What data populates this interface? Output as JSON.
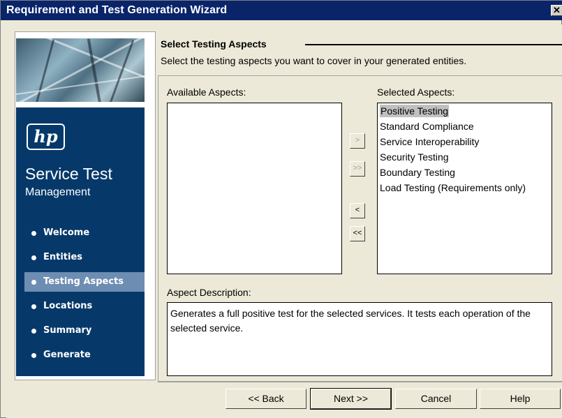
{
  "window": {
    "title": "Requirement and Test Generation Wizard",
    "close_glyph": "✕"
  },
  "sidebar": {
    "logo_text": "hp",
    "product_title": "Service Test",
    "product_subtitle": "Management",
    "steps": [
      {
        "label": "Welcome",
        "active": false
      },
      {
        "label": "Entities",
        "active": false
      },
      {
        "label": "Testing Aspects",
        "active": true
      },
      {
        "label": "Locations",
        "active": false
      },
      {
        "label": "Summary",
        "active": false
      },
      {
        "label": "Generate",
        "active": false
      }
    ]
  },
  "header": {
    "title": "Select Testing Aspects",
    "description": "Select the testing aspects you want to cover in your generated entities."
  },
  "available": {
    "label": "Available Aspects:",
    "items": []
  },
  "selected": {
    "label": "Selected Aspects:",
    "items": [
      "Positive Testing",
      "Standard Compliance",
      "Service Interoperability",
      "Security Testing",
      "Boundary Testing",
      "Load Testing (Requirements only)"
    ],
    "selected_index": 0
  },
  "move_buttons": {
    "add": ">",
    "add_all": ">>",
    "remove": "<",
    "remove_all": "<<"
  },
  "description": {
    "label": "Aspect Description:",
    "text": "Generates a full positive test for the selected services. It tests each operation of the selected service."
  },
  "buttons": {
    "back": "<< Back",
    "next": "Next >>",
    "cancel": "Cancel",
    "help": "Help"
  },
  "icons": {
    "bullet": "bullet-icon"
  }
}
